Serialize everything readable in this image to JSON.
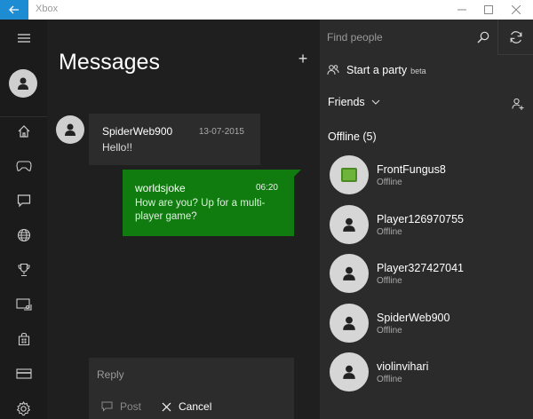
{
  "window": {
    "title": "Xbox",
    "controls": [
      "minimize",
      "maximize",
      "close"
    ]
  },
  "rail": {
    "items": [
      {
        "name": "home",
        "icon": "home-icon"
      },
      {
        "name": "game-dvr",
        "icon": "gamepad-icon"
      },
      {
        "name": "messages",
        "icon": "chat-icon"
      },
      {
        "name": "activity-feed",
        "icon": "globe-icon"
      },
      {
        "name": "achievements",
        "icon": "trophy-icon"
      },
      {
        "name": "connect",
        "icon": "console-icon"
      },
      {
        "name": "store",
        "icon": "store-icon"
      },
      {
        "name": "onedrive",
        "icon": "card-icon"
      },
      {
        "name": "settings",
        "icon": "gear-icon"
      }
    ]
  },
  "messages": {
    "title": "Messages",
    "add_label": "+",
    "conversation": [
      {
        "sender": "SpiderWeb900",
        "date": "13-07-2015",
        "text": "Hello!!",
        "direction": "incoming"
      },
      {
        "sender": "worldsjoke",
        "date": "06:20",
        "text": "How are you? Up for a multi-player game?",
        "direction": "outgoing"
      }
    ],
    "reply": {
      "placeholder": "Reply",
      "post_label": "Post",
      "cancel_label": "Cancel"
    }
  },
  "people": {
    "search_placeholder": "Find people",
    "party_label": "Start a party",
    "party_badge": "beta",
    "friends_label": "Friends",
    "offline_header": "Offline (5)",
    "friends": [
      {
        "name": "FrontFungus8",
        "status": "Offline",
        "avatar": "green-tile"
      },
      {
        "name": "Player126970755",
        "status": "Offline",
        "avatar": "default"
      },
      {
        "name": "Player327427041",
        "status": "Offline",
        "avatar": "default"
      },
      {
        "name": "SpiderWeb900",
        "status": "Offline",
        "avatar": "default"
      },
      {
        "name": "violinvihari",
        "status": "Offline",
        "avatar": "default"
      }
    ]
  },
  "colors": {
    "accent_blue": "#1e8cd2",
    "xbox_green": "#107c10",
    "rail_bg": "#1b1b1b",
    "pane_bg": "#1f1f1f",
    "people_bg": "#2b2b2b"
  }
}
